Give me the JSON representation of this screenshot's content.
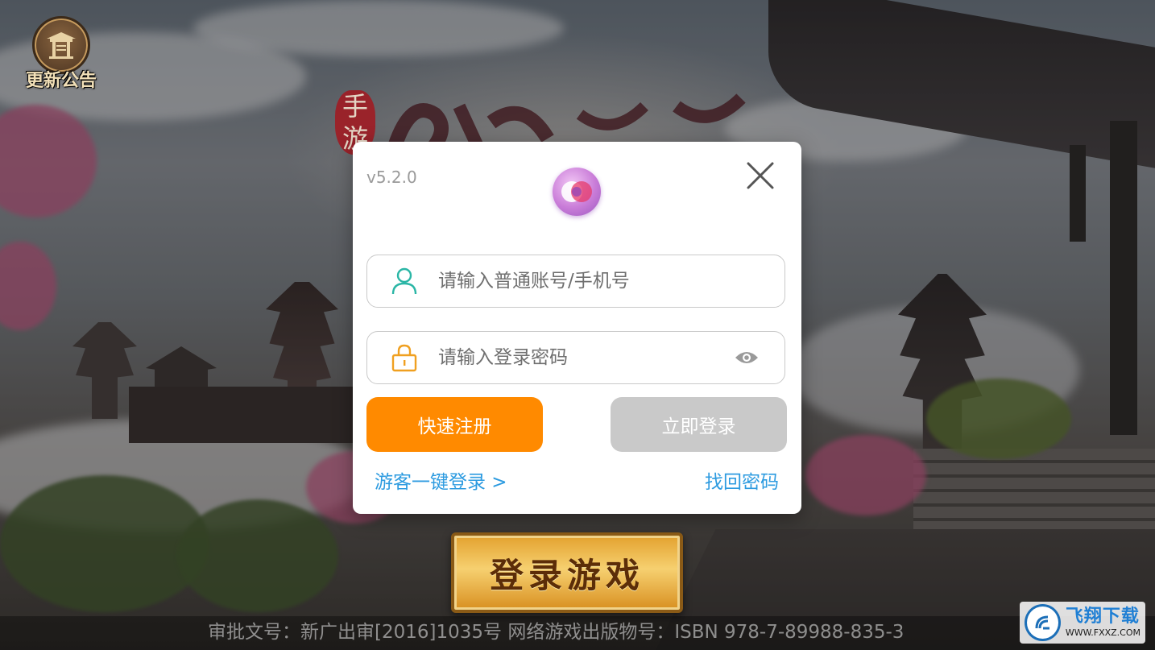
{
  "notice": {
    "label": "更新公告",
    "icon": "pavilion-icon"
  },
  "title_art": {
    "seal": "手游"
  },
  "dialog": {
    "version": "v5.2.0",
    "logo_icon": "app-logo",
    "close_icon": "close-icon",
    "account_field": {
      "placeholder": "请输入普通账号/手机号",
      "value": "",
      "icon": "user-icon"
    },
    "password_field": {
      "placeholder": "请输入登录密码",
      "value": "",
      "icon": "lock-icon",
      "toggle_icon": "eye-icon"
    },
    "register_button": "快速注册",
    "login_button": "立即登录",
    "guest_login_link": "游客一键登录 >",
    "forgot_password_link": "找回密码",
    "colors": {
      "register": "#ff8a00",
      "login_disabled": "#c9c9c9",
      "link": "#2d9be0",
      "user_icon": "#2bb6a6",
      "lock_icon": "#f0a020"
    }
  },
  "game_login_button": "登录游戏",
  "footer": {
    "approval_text": "审批文号：新广出审[2016]1035号  网络游戏出版物号：ISBN 978-7-89988-835-3"
  },
  "watermark": {
    "brand": "飞翔下载",
    "url": "WWW.FXXZ.COM"
  }
}
